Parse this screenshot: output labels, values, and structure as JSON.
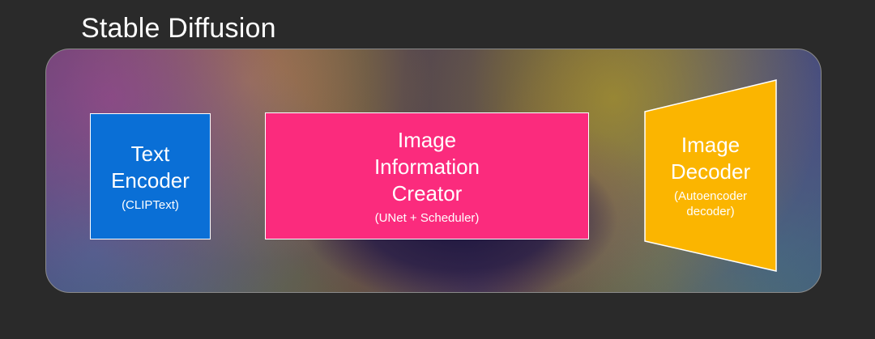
{
  "diagram": {
    "title": "Stable Diffusion",
    "components": [
      {
        "name": "Text Encoder",
        "detail": "(CLIPText)",
        "color": "#0a6fd6"
      },
      {
        "name": "Image Information Creator",
        "detail": "(UNet + Scheduler)",
        "color": "#fb2b7d"
      },
      {
        "name": "Image Decoder",
        "detail": "(Autoencoder decoder)",
        "color": "#fbb500"
      }
    ],
    "colors": {
      "background": "#2a2a2a",
      "text": "#ffffff",
      "panel_border": "#8a8a8a"
    },
    "background_image": "colorful eye close-up"
  }
}
